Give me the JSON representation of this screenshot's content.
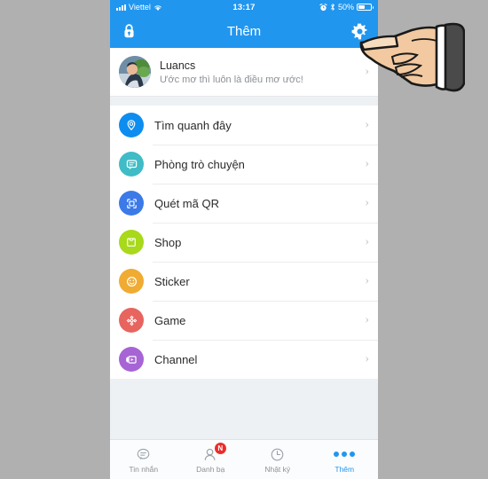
{
  "status_bar": {
    "carrier": "Viettel",
    "time": "13:17",
    "battery_pct": "50%",
    "signal_icon": "signal-bars-icon",
    "wifi_icon": "wifi-icon",
    "alarm_icon": "alarm-clock-icon",
    "bluetooth_icon": "bluetooth-icon",
    "battery_icon": "battery-icon"
  },
  "nav_bar": {
    "title": "Thêm",
    "left_icon": "lock-icon",
    "right_icon": "gear-icon",
    "background_color": "#2196ef"
  },
  "profile": {
    "name": "Luancs",
    "status": "Ước mơ thì luôn là điều mơ ước!",
    "avatar_icon": "user-avatar",
    "chevron": "›"
  },
  "menu": {
    "chevron": "›",
    "items": [
      {
        "label": "Tìm quanh đây",
        "icon": "location-pin-icon",
        "color": "#0d8df0"
      },
      {
        "label": "Phòng trò chuyện",
        "icon": "chat-bubble-icon",
        "color": "#3fbcc6"
      },
      {
        "label": "Quét mã QR",
        "icon": "qr-scan-icon",
        "color": "#3b7ae8"
      },
      {
        "label": "Shop",
        "icon": "shopping-bag-icon",
        "color": "#a8d91a"
      },
      {
        "label": "Sticker",
        "icon": "smiley-face-icon",
        "color": "#f0ab33"
      },
      {
        "label": "Game",
        "icon": "gamepad-icon",
        "color": "#e8645f"
      },
      {
        "label": "Channel",
        "icon": "channel-icon",
        "color": "#a764d4"
      }
    ]
  },
  "tab_bar": {
    "tabs": [
      {
        "label": "Tin nhắn",
        "icon": "message-icon",
        "active": false,
        "badge": ""
      },
      {
        "label": "Danh bạ",
        "icon": "contacts-icon",
        "active": false,
        "badge": "N"
      },
      {
        "label": "Nhật ký",
        "icon": "clock-icon",
        "active": false,
        "badge": ""
      },
      {
        "label": "Thêm",
        "icon": "more-dots-icon",
        "active": true,
        "badge": ""
      }
    ],
    "active_color": "#2196ef",
    "badge_color": "#ee2b2b"
  },
  "overlay": {
    "pointer_icon": "pointing-hand-cursor"
  }
}
